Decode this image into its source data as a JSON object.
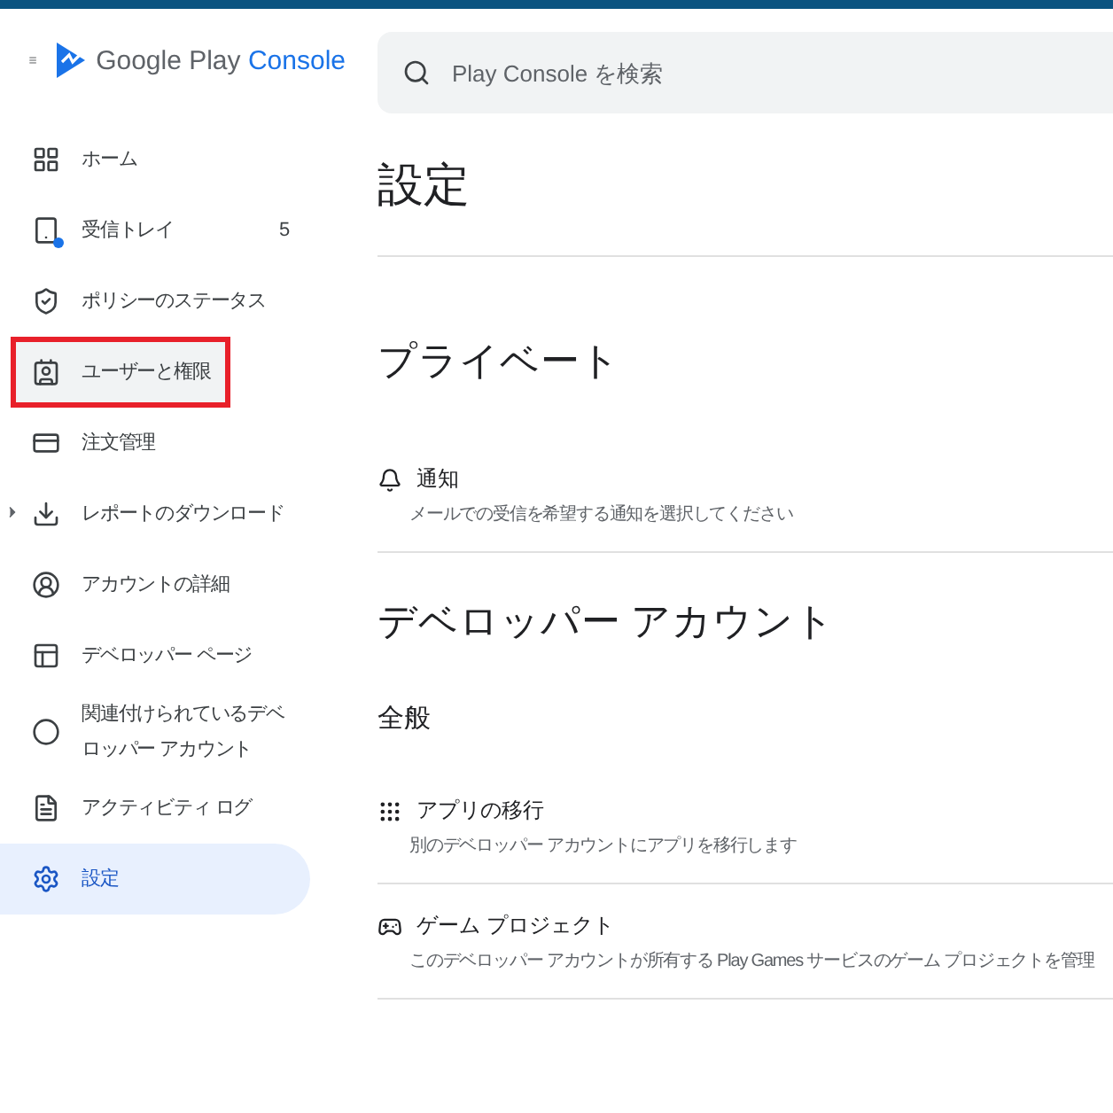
{
  "header": {
    "product": "Google Play",
    "product_suffix": "Console",
    "search": {
      "placeholder": "Play Console を検索"
    }
  },
  "sidebar": {
    "items": [
      {
        "label": "ホーム",
        "selected": false,
        "hovered": false,
        "highlighted": false
      },
      {
        "label": "受信トレイ",
        "count": "5",
        "selected": false,
        "hovered": false,
        "highlighted": false
      },
      {
        "label": "ポリシーのステータス",
        "selected": false,
        "hovered": false,
        "highlighted": false
      },
      {
        "label": "ユーザーと権限",
        "selected": false,
        "hovered": true,
        "highlighted": true
      },
      {
        "label": "注文管理",
        "selected": false,
        "hovered": false,
        "highlighted": false
      },
      {
        "label": "レポートのダウンロード",
        "expandable": true,
        "selected": false,
        "hovered": false,
        "highlighted": false
      },
      {
        "label": "アカウントの詳細",
        "selected": false,
        "hovered": false,
        "highlighted": false
      },
      {
        "label": "デベロッパー ページ",
        "selected": false,
        "hovered": false,
        "highlighted": false
      },
      {
        "label": "関連付けられているデベロッパー アカウント",
        "selected": false,
        "hovered": false,
        "highlighted": false
      },
      {
        "label": "アクティビティ ログ",
        "selected": false,
        "hovered": false,
        "highlighted": false
      },
      {
        "label": "設定",
        "selected": true,
        "hovered": false,
        "highlighted": false
      }
    ]
  },
  "page": {
    "title": "設定",
    "sections": [
      {
        "heading": "プライベート",
        "groups": [
          {
            "items": [
              {
                "title": "通知",
                "description": "メールでの受信を希望する通知を選択してください"
              }
            ]
          }
        ]
      },
      {
        "heading": "デベロッパー アカウント",
        "groups": [
          {
            "heading": "全般",
            "items": [
              {
                "title": "アプリの移行",
                "description": "別のデベロッパー アカウントにアプリを移行します"
              },
              {
                "title": "ゲーム プロジェクト",
                "description": "このデベロッパー アカウントが所有する Play Games サービスのゲーム プロジェクトを管理"
              }
            ]
          }
        ]
      }
    ]
  }
}
